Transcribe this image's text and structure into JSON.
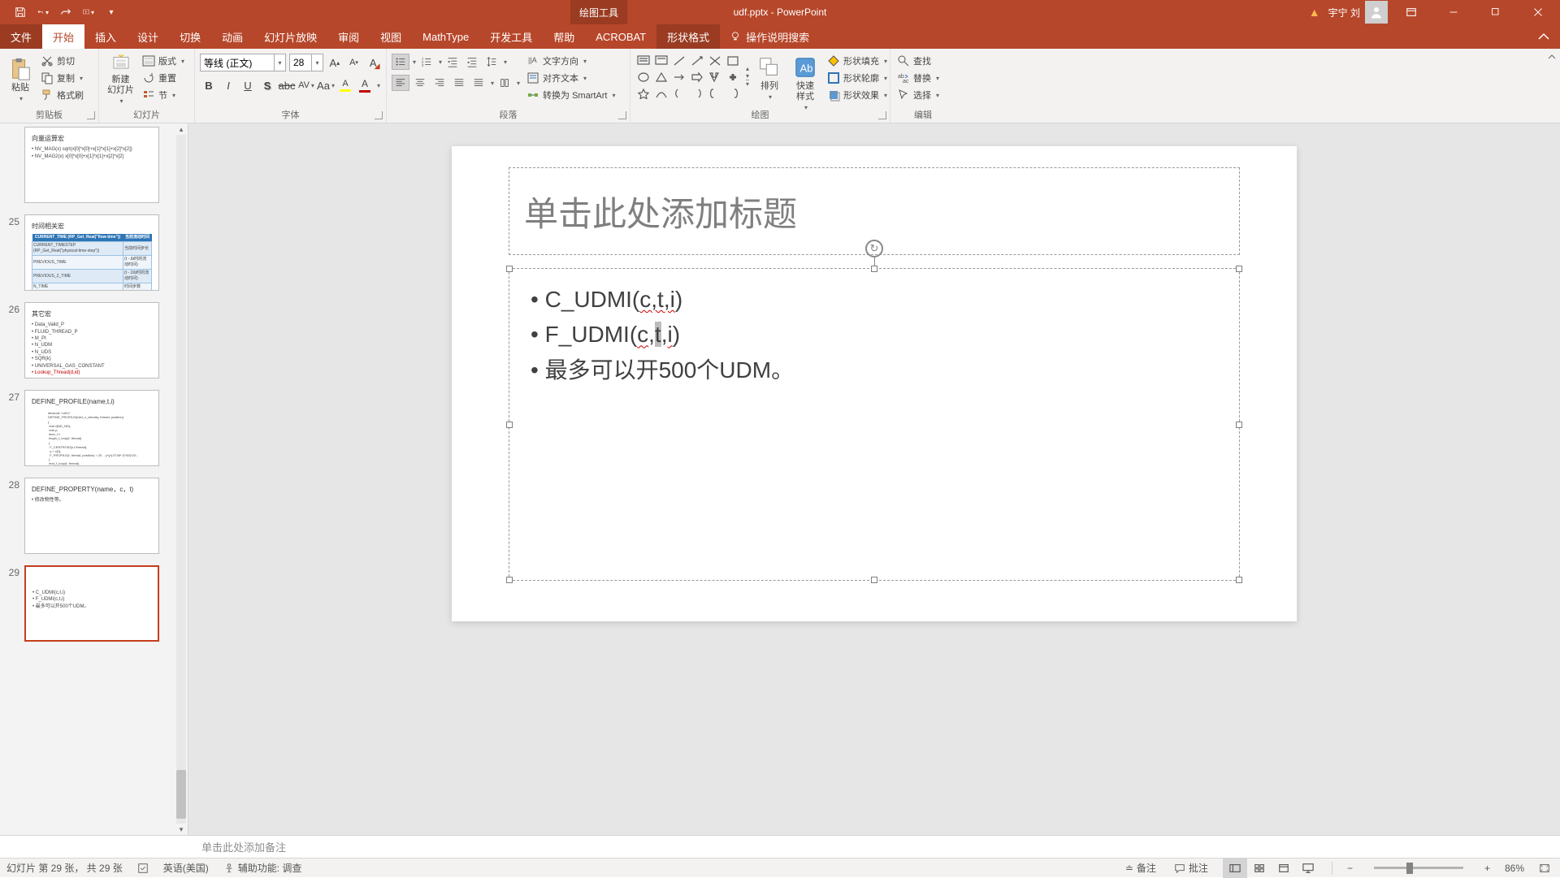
{
  "titlebar": {
    "doc": "udf.pptx  -  PowerPoint",
    "tooltab": "绘图工具",
    "user": "宇宁 刘"
  },
  "tabs": {
    "file": "文件",
    "home": "开始",
    "insert": "插入",
    "design": "设计",
    "transitions": "切换",
    "animations": "动画",
    "slideshow": "幻灯片放映",
    "review": "审阅",
    "view": "视图",
    "mathtype": "MathType",
    "developer": "开发工具",
    "help": "帮助",
    "acrobat": "ACROBAT",
    "shapeformat": "形状格式",
    "tellme": "操作说明搜索"
  },
  "ribbon": {
    "clipboard": {
      "paste": "粘贴",
      "cut": "剪切",
      "copy": "复制",
      "painter": "格式刷",
      "label": "剪贴板"
    },
    "slides": {
      "new": "新建\n幻灯片",
      "layout": "版式",
      "reset": "重置",
      "section": "节",
      "label": "幻灯片"
    },
    "font": {
      "name": "等线 (正文)",
      "size": "28",
      "label": "字体"
    },
    "para": {
      "direction": "文字方向",
      "align": "对齐文本",
      "smartart": "转换为 SmartArt",
      "label": "段落"
    },
    "draw": {
      "arrange": "排列",
      "quickstyle": "快速样式",
      "fill": "形状填充",
      "outline": "形状轮廓",
      "effects": "形状效果",
      "label": "绘图"
    },
    "edit": {
      "find": "查找",
      "replace": "替换",
      "select": "选择",
      "label": "编辑"
    }
  },
  "thumbs": [
    {
      "num": "",
      "title": "向量运算宏",
      "lines": [
        "• NV_MAG(x)    sqrt(x[0]*x[0]+x[1]*x[1]+x[2]*x[2])",
        "• NV_MAG2(x)   x[0]*x[0]+x[1]*x[1]+x[2]*x[2]"
      ]
    },
    {
      "num": "25",
      "title": "时间相关宏"
    },
    {
      "num": "26",
      "title": "其它宏",
      "lines": [
        "• Data_Valid_P",
        "• FLUID_THREAD_P",
        "• M_PI",
        "• N_UDM",
        "• N_UDS",
        "• SQR(k)",
        "• UNIVERSAL_GAS_CONSTANT",
        "• Lookup_Thread(d,id)"
      ]
    },
    {
      "num": "27",
      "title": "DEFINE_PROFILE(name,t,i)"
    },
    {
      "num": "28",
      "title": "DEFINE_PROPERTY(name，c，t)",
      "lines": [
        "• 修改物性等。"
      ]
    },
    {
      "num": "29",
      "lines": [
        "• C_UDMI(c,t,i)",
        "• F_UDMI(c,t,i)",
        "• 最多可以开500个UDM。"
      ]
    }
  ],
  "slide": {
    "titleph": "单击此处添加标题",
    "body": [
      "C_UDMI(c,t,i)",
      "F_UDMI(c,t,i)",
      "最多可以开500个UDM。"
    ]
  },
  "notes": {
    "placeholder": "单击此处添加备注"
  },
  "status": {
    "slide": "幻灯片 第 29 张， 共 29 张",
    "lang": "英语(美国)",
    "a11y": "辅助功能: 调查",
    "notesbtn": "备注",
    "comments": "批注",
    "zoom": "86%"
  }
}
